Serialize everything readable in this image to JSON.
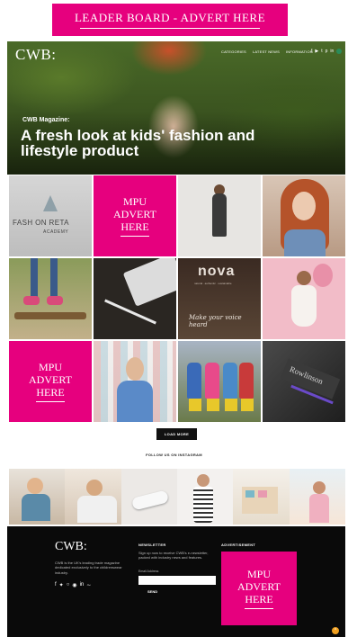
{
  "leaderboard": {
    "label": "LEADER BOARD - ADVERT HERE"
  },
  "header": {
    "logo": "CWB:",
    "nav": [
      "CATEGORIES",
      "LATEST NEWS",
      "INFORMATION"
    ],
    "social": [
      "f",
      "y",
      "t",
      "p",
      "in",
      "rss"
    ],
    "accent": "#2a8c5a"
  },
  "hero": {
    "kicker": "CWB Magazine:",
    "headline": "A fresh look at kids' fashion and lifestyle product"
  },
  "ads": {
    "mpu_lines": [
      "MPU",
      "ADVERT",
      "HERE"
    ],
    "brand_color": "#e6007e"
  },
  "tiles": {
    "fashion_retail": {
      "text": "FASH ON RETA",
      "sub": "ACADEMY"
    },
    "nova": {
      "logo": "nova",
      "tagline": "natural . authentic . sustainable",
      "script": "Make your voice heard"
    },
    "rowlinson": {
      "text": "Rowlinson"
    }
  },
  "load_more": "LOAD MORE",
  "instagram": {
    "title": "FOLLOW US ON INSTAGRAM"
  },
  "footer": {
    "logo": "CWB:",
    "about": "CWB is the UK's leading trade magazine dedicated exclusively to the childrenswear industry.",
    "social": [
      "f",
      "y",
      "ig",
      "p",
      "in",
      "rss"
    ],
    "newsletter_heading": "NEWSLETTER",
    "newsletter_text": "Sign up now to receive CWB's e-newsletter, packed with industry news and features.",
    "email_label": "Email Address",
    "email_value": "",
    "email_placeholder": "",
    "send_label": "SEND",
    "advert_heading": "ADVERTISEMENT"
  },
  "scroll_top": "^"
}
